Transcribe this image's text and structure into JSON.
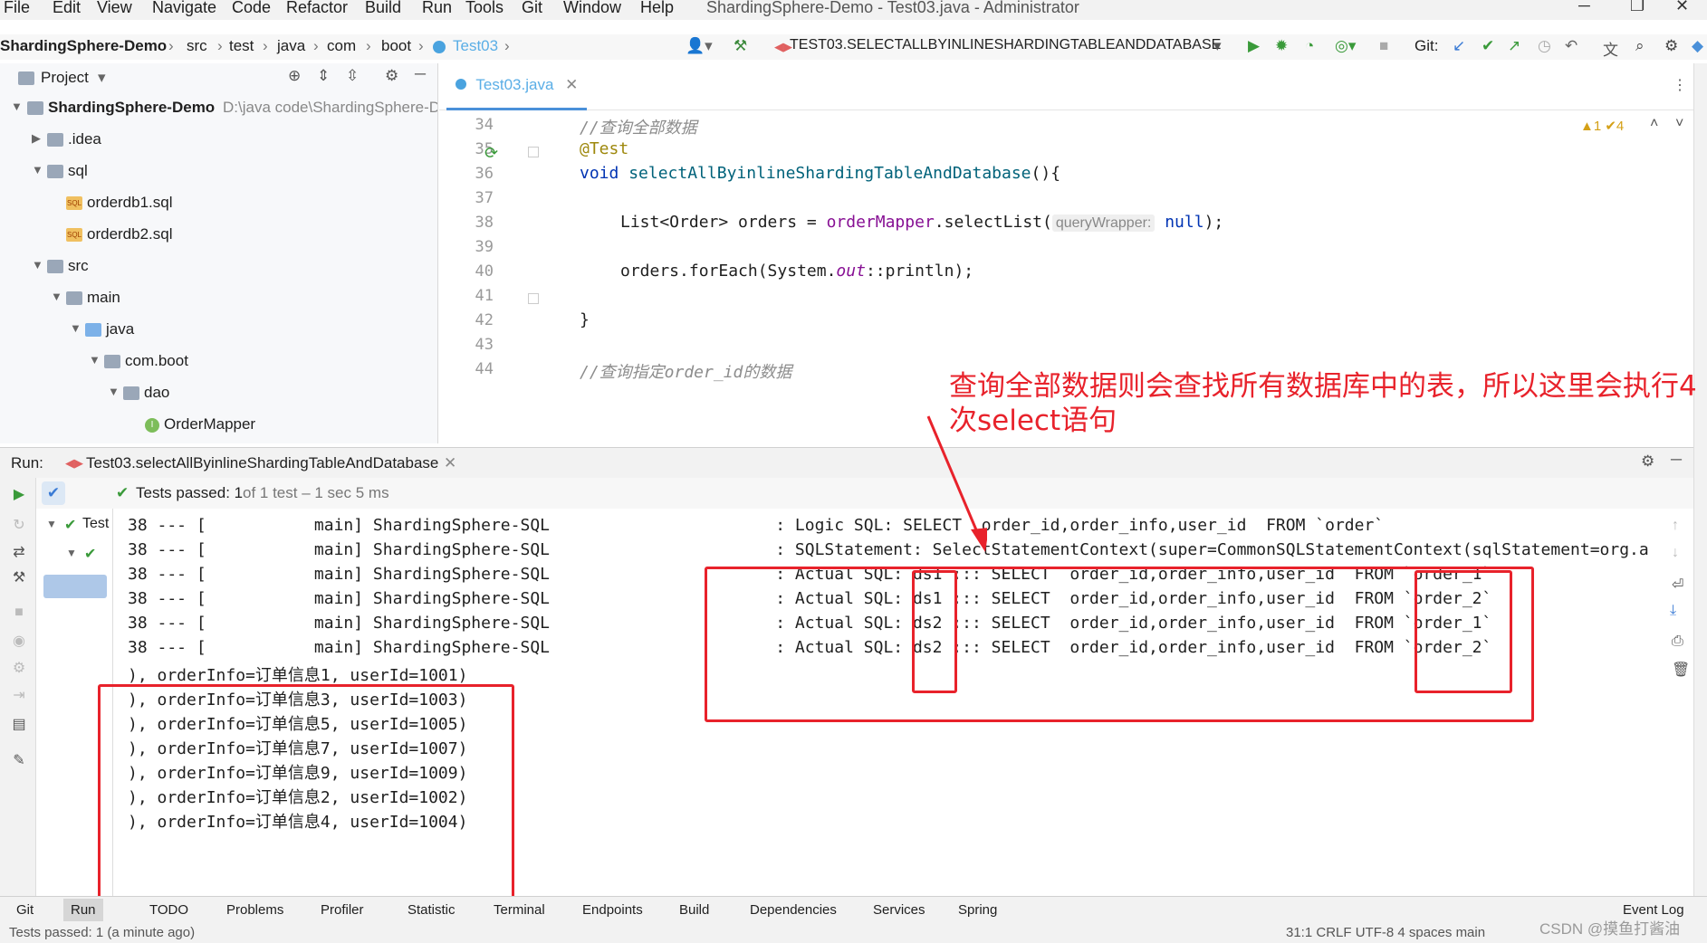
{
  "menu": {
    "items": [
      "File",
      "Edit",
      "View",
      "Navigate",
      "Code",
      "Refactor",
      "Build",
      "Run",
      "Tools",
      "Git",
      "Window",
      "Help"
    ],
    "window_title": "ShardingSphere-Demo - Test03.java - Administrator"
  },
  "breadcrumb": {
    "items": [
      "ShardingSphere-Demo",
      "src",
      "test",
      "java",
      "com",
      "boot",
      "Test03"
    ],
    "run_config": "TEST03.SELECTALLBYINLINESHARDINGTABLEANDDATABASE",
    "git_label": "Git:"
  },
  "project": {
    "title": "Project",
    "root": "ShardingSphere-Demo",
    "root_path": "D:\\java code\\ShardingSphere-D",
    "items": [
      ".idea",
      "sql",
      "orderdb1.sql",
      "orderdb2.sql",
      "src",
      "main",
      "java",
      "com.boot",
      "dao",
      "OrderMapper"
    ]
  },
  "editor": {
    "tab": "Test03.java",
    "line_numbers": [
      "34",
      "35",
      "36",
      "37",
      "38",
      "39",
      "40",
      "41",
      "42",
      "43",
      "44"
    ],
    "comment1": "//查询全部数据",
    "annotation": "@Test",
    "kw_void": "void",
    "method_name": "selectAllByinlineShardingTableAndDatabase",
    "method_tail": "(){",
    "line38_a": "List<Order> orders = ",
    "line38_field": "orderMapper",
    "line38_b": ".selectList(",
    "line38_hint": "queryWrapper:",
    "line38_null": "null",
    "line38_c": ");",
    "line40_a": "orders.forEach(System.",
    "line40_out": "out",
    "line40_b": "::println);",
    "line42": "}",
    "comment2": "//查询指定order_id的数据",
    "inspections": "▲1  ✔4"
  },
  "run": {
    "label": "Run:",
    "tab": "Test03.selectAllByinlineShardingTableAndDatabase",
    "tests_passed": "Tests passed: 1",
    "tests_detail": "of 1 test – 1 sec 5 ms",
    "tree_item": "Test"
  },
  "console": {
    "lines": [
      "38 --- [           main] ShardingSphere-SQL                       : Logic SQL: SELECT  order_id,order_info,user_id  FROM `order`",
      "38 --- [           main] ShardingSphere-SQL                       : SQLStatement: SelectStatementContext(super=CommonSQLStatementContext(sqlStatement=org.a",
      "38 --- [           main] ShardingSphere-SQL                       : Actual SQL: ds1 ::: SELECT  order_id,order_info,user_id  FROM `order_1`",
      "38 --- [           main] ShardingSphere-SQL                       : Actual SQL: ds1 ::: SELECT  order_id,order_info,user_id  FROM `order_2`",
      "38 --- [           main] ShardingSphere-SQL                       : Actual SQL: ds2 ::: SELECT  order_id,order_info,user_id  FROM `order_1`",
      "38 --- [           main] ShardingSphere-SQL                       : Actual SQL: ds2 ::: SELECT  order_id,order_info,user_id  FROM `order_2`",
      "), orderInfo=订单信息1, userId=1001)",
      "), orderInfo=订单信息3, userId=1003)",
      "), orderInfo=订单信息5, userId=1005)",
      "), orderInfo=订单信息7, userId=1007)",
      "), orderInfo=订单信息9, userId=1009)",
      "), orderInfo=订单信息2, userId=1002)",
      "), orderInfo=订单信息4, userId=1004)"
    ]
  },
  "annotation_text": "查询全部数据则会查找所有数据库中的表，所以这里会执行4次select语句",
  "bottom_tabs": [
    "Git",
    "Run",
    "TODO",
    "Problems",
    "Profiler",
    "Statistic",
    "Terminal",
    "Endpoints",
    "Build",
    "Dependencies",
    "Services",
    "Spring"
  ],
  "event_log": "Event Log",
  "status": {
    "left": "Tests passed: 1 (a minute ago)",
    "right": "31:1  CRLF  UTF-8  4 spaces  main"
  },
  "watermark": "CSDN @摸鱼打酱油",
  "colors": {
    "annotation_red": "#e8222b",
    "accent_blue": "#4a90d9",
    "pass_green": "#4caf50"
  }
}
